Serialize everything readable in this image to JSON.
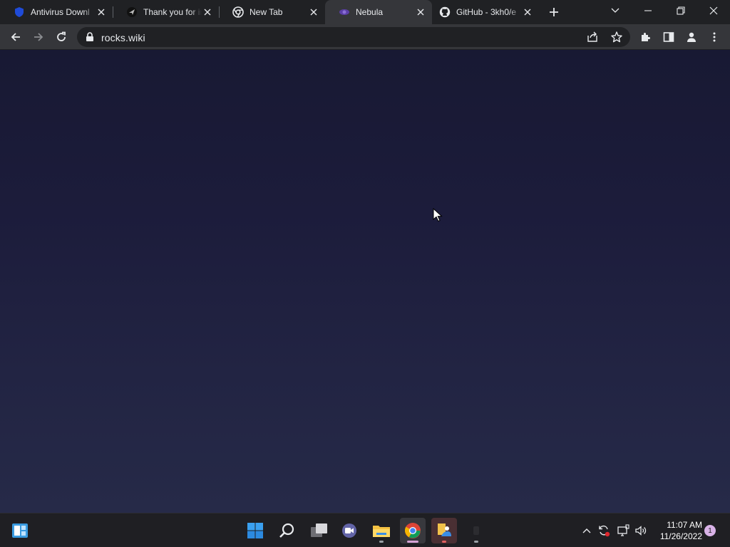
{
  "browser": {
    "tabs": [
      {
        "title": "Antivirus Downl",
        "favicon": "shield-icon",
        "active": false
      },
      {
        "title": "Thank you for in",
        "favicon": "send-icon",
        "active": false
      },
      {
        "title": "New Tab",
        "favicon": "chrome-icon",
        "active": false
      },
      {
        "title": "Nebula",
        "favicon": "nebula-icon",
        "active": true
      },
      {
        "title": "GitHub - 3kh0/e",
        "favicon": "github-icon",
        "active": false
      }
    ],
    "new_tab_label": "+",
    "address": "rocks.wiki"
  },
  "taskbar": {
    "apps": [
      "start",
      "search",
      "task-view",
      "teams-chat",
      "file-explorer",
      "chrome",
      "app",
      "app-unknown"
    ],
    "time": "11:07 AM",
    "date": "11/26/2022",
    "notification_count": "1"
  },
  "colors": {
    "tab_strip": "#202124",
    "toolbar": "#35363a",
    "page_top": "#181933",
    "page_bottom": "#262a48",
    "taskbar": "#1f1f23"
  }
}
